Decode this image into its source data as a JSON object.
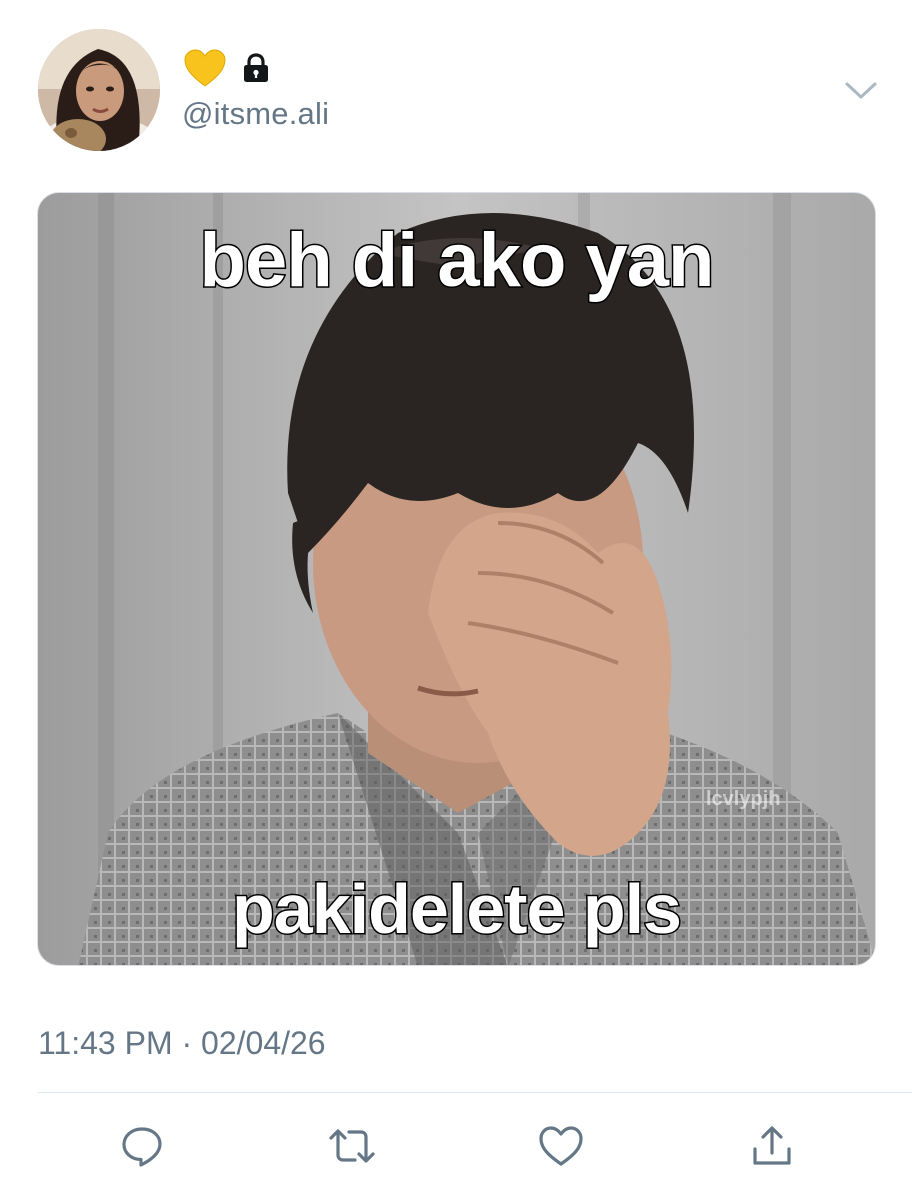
{
  "user": {
    "handle": "@itsme.ali",
    "name_emoji": "yellow-heart-icon",
    "protected_icon": "lock-icon"
  },
  "media": {
    "caption_top": "beh di ako yan",
    "caption_bottom": "pakidelete pls",
    "watermark": "lcvlypjh"
  },
  "tweet": {
    "timestamp": "11:43 PM · 02/04/26"
  },
  "actions": {
    "reply_icon": "reply-icon",
    "retweet_icon": "retweet-icon",
    "like_icon": "like-icon",
    "share_icon": "share-icon"
  },
  "colors": {
    "secondary_text": "#657786",
    "icon_gray": "#657786",
    "heart_yellow": "#F7C31C",
    "divider": "#E1E8ED"
  }
}
